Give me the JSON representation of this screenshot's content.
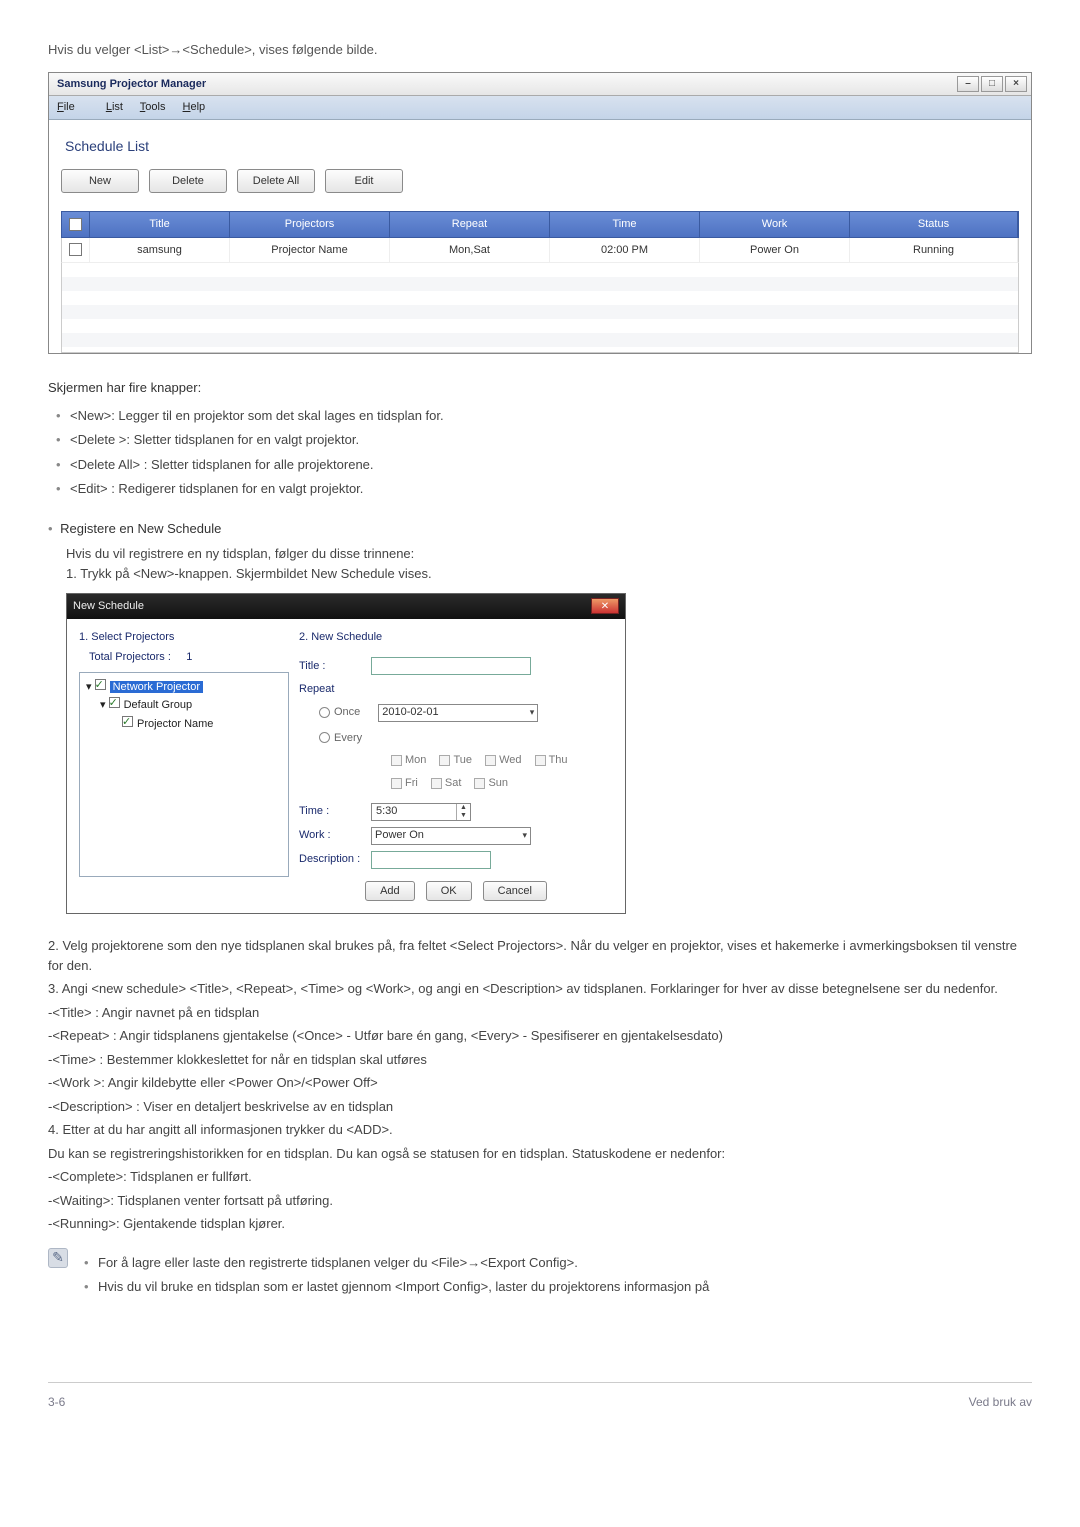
{
  "intro": "Hvis du velger <List>→<Schedule>, vises følgende bilde.",
  "win1": {
    "title": "Samsung Projector Manager",
    "menu": {
      "file": "File",
      "list": "List",
      "tools": "Tools",
      "help": "Help"
    },
    "heading": "Schedule List",
    "buttons": {
      "new": "New",
      "delete": "Delete",
      "deleteAll": "Delete All",
      "edit": "Edit"
    },
    "columns": {
      "title": "Title",
      "projectors": "Projectors",
      "repeat": "Repeat",
      "time": "Time",
      "work": "Work",
      "status": "Status"
    },
    "row": {
      "title": "samsung",
      "projectors": "Projector Name",
      "repeat": "Mon,Sat",
      "time": "02:00 PM",
      "work": "Power On",
      "status": "Running"
    }
  },
  "screenDesc": "Skjermen har fire knapper:",
  "buttonDescs": [
    "<New>: Legger til en projektor som det skal lages en tidsplan for.",
    "<Delete >: Sletter tidsplanen for en valgt projektor.",
    "<Delete All> : Sletter tidsplanen for alle projektorene.",
    "<Edit> : Redigerer tidsplanen for en valgt projektor."
  ],
  "registerHeading": "Registere en New Schedule",
  "registerIntro": "Hvis du vil registrere en ny tidsplan, følger du disse trinnene:",
  "step1": "1. Trykk på <New>-knappen. Skjermbildet New Schedule vises.",
  "win2": {
    "title": "New Schedule",
    "left": {
      "heading": "1. Select Projectors",
      "totalLabel": "Total Projectors :",
      "totalValue": "1",
      "tree": {
        "root": "Network Projector",
        "group": "Default Group",
        "item": "Projector Name"
      }
    },
    "right": {
      "heading": "2. New Schedule",
      "titleLabel": "Title :",
      "repeatLabel": "Repeat",
      "once": "Once",
      "onceDate": "2010-02-01",
      "every": "Every",
      "days": {
        "mon": "Mon",
        "tue": "Tue",
        "wed": "Wed",
        "thu": "Thu",
        "fri": "Fri",
        "sat": "Sat",
        "sun": "Sun"
      },
      "timeLabel": "Time :",
      "timeValue": "5:30",
      "workLabel": "Work :",
      "workValue": "Power On",
      "descLabel": "Description :"
    },
    "buttons": {
      "add": "Add",
      "ok": "OK",
      "cancel": "Cancel"
    }
  },
  "step2": "2. Velg projektorene som den nye tidsplanen skal brukes på, fra feltet <Select Projectors>. Når du velger en projektor, vises et hakemerke i avmerkingsboksen til venstre for den.",
  "step3": "3. Angi <new schedule> <Title>, <Repeat>, <Time> og <Work>, og angi en <Description> av tidsplanen. Forklaringer for hver av disse betegnelsene ser du nedenfor.",
  "defs": [
    "-<Title> : Angir navnet på en tidsplan",
    "-<Repeat> : Angir tidsplanens gjentakelse (<Once> - Utfør bare én gang, <Every> - Spesifiserer en gjentakelsesdato)",
    "-<Time> : Bestemmer klokkeslettet for når en tidsplan skal utføres",
    "-<Work >: Angir kildebytte eller <Power On>/<Power Off>",
    "-<Description> : Viser en detaljert beskrivelse av en tidsplan"
  ],
  "step4": "4. Etter at du har angitt all informasjonen trykker du <ADD>.",
  "historyLine": "Du kan se registreringshistorikken for en tidsplan. Du kan også se statusen for en tidsplan. Statuskodene er nedenfor:",
  "statuses": [
    "-<Complete>: Tidsplanen er fullført.",
    "-<Waiting>: Tidsplanen venter fortsatt på utføring.",
    "-<Running>: Gjentakende tidsplan kjører."
  ],
  "notes": [
    "For å lagre eller laste den registrerte tidsplanen velger du <File>→<Export Config>.",
    "Hvis du vil bruke en tidsplan som er lastet gjennom <Import Config>, laster du projektorens informasjon på"
  ],
  "footer": {
    "left": "3-6",
    "right": "Ved bruk av"
  }
}
